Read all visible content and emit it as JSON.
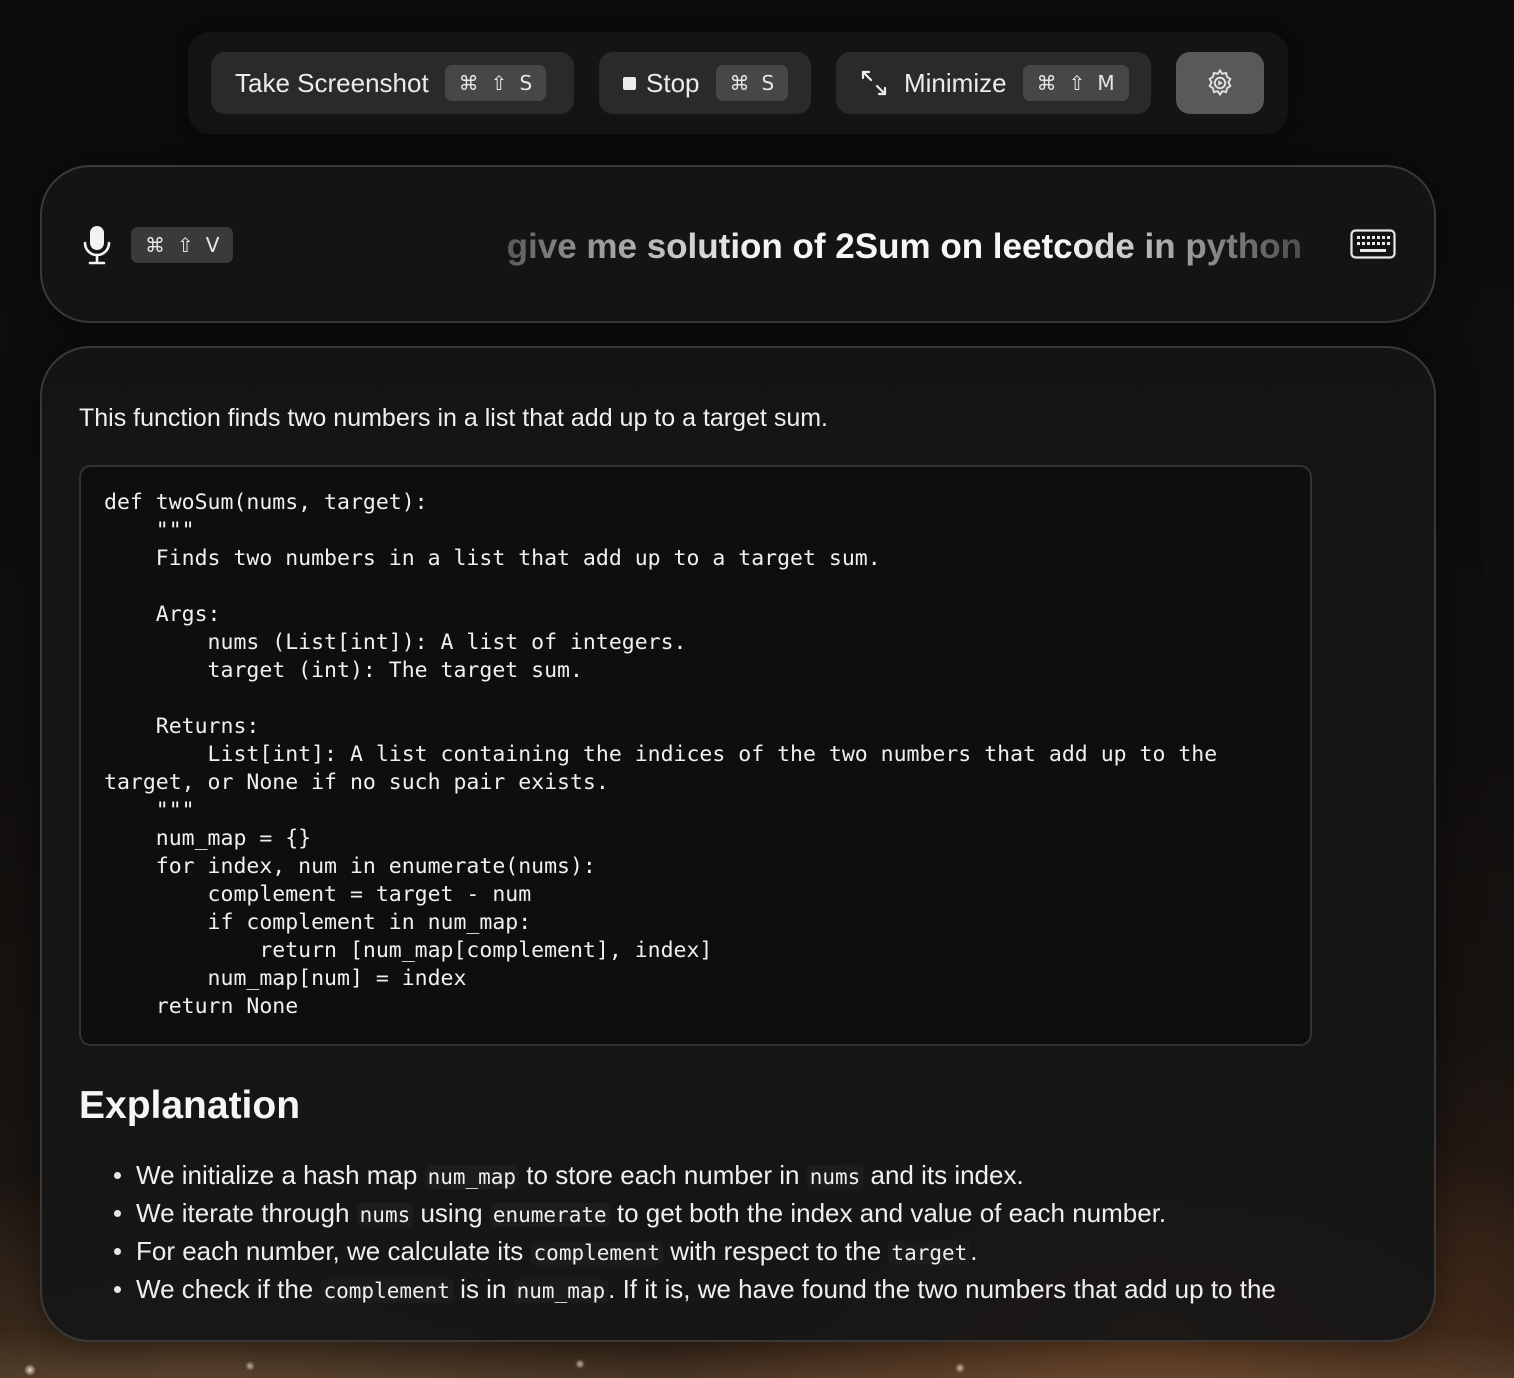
{
  "toolbar": {
    "screenshot": {
      "label": "Take Screenshot",
      "shortcut": [
        "⌘",
        "⇧",
        "S"
      ]
    },
    "stop": {
      "label": "Stop",
      "shortcut": [
        "⌘",
        "S"
      ]
    },
    "minimize": {
      "label": "Minimize",
      "shortcut": [
        "⌘",
        "⇧",
        "M"
      ]
    },
    "settings_icon": "gear-icon"
  },
  "input": {
    "mic_shortcut": [
      "⌘",
      "⇧",
      "V"
    ],
    "prompt_text": "give me solution of 2Sum on leetcode in python",
    "mic_icon": "microphone-icon",
    "keyboard_icon": "keyboard-icon"
  },
  "response": {
    "intro": "This function finds two numbers in a list that add up to a target sum.",
    "code": "def twoSum(nums, target):\n    \"\"\"\n    Finds two numbers in a list that add up to a target sum.\n\n    Args:\n        nums (List[int]): A list of integers.\n        target (int): The target sum.\n\n    Returns:\n        List[int]: A list containing the indices of the two numbers that add up to the\ntarget, or None if no such pair exists.\n    \"\"\"\n    num_map = {}\n    for index, num in enumerate(nums):\n        complement = target - num\n        if complement in num_map:\n            return [num_map[complement], index]\n        num_map[num] = index\n    return None",
    "explanation_title": "Explanation",
    "bullets": [
      [
        {
          "t": "We initialize a hash map "
        },
        {
          "c": "num_map"
        },
        {
          "t": " to store each number in "
        },
        {
          "c": "nums"
        },
        {
          "t": " and its index."
        }
      ],
      [
        {
          "t": "We iterate through "
        },
        {
          "c": "nums"
        },
        {
          "t": " using "
        },
        {
          "c": "enumerate"
        },
        {
          "t": " to get both the index and value of each number."
        }
      ],
      [
        {
          "t": "For each number, we calculate its "
        },
        {
          "c": "complement"
        },
        {
          "t": " with respect to the "
        },
        {
          "c": "target"
        },
        {
          "t": "."
        }
      ],
      [
        {
          "t": "We check if the "
        },
        {
          "c": "complement"
        },
        {
          "t": " is in "
        },
        {
          "c": "num_map"
        },
        {
          "t": ". If it is, we have found the two numbers that add up to the"
        }
      ]
    ]
  }
}
